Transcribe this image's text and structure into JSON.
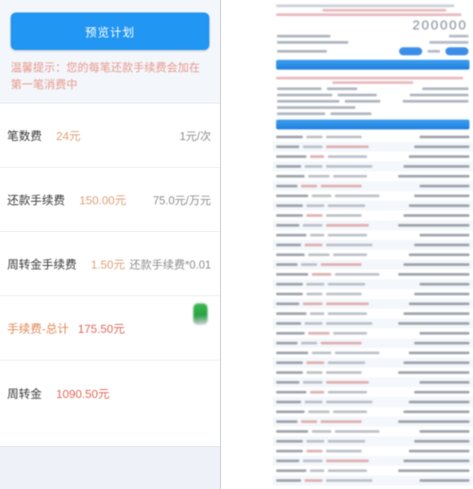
{
  "app": {
    "left_panel_name": "fee-calculation-panel",
    "right_panel_name": "plan-document-preview"
  },
  "hero": {
    "preview_button_label": "预览计划",
    "warning_text": "温馨提示：您的每笔还款手续费会加在第一笔消费中",
    "button_color": "#2196f3",
    "warning_color": "#e8998c"
  },
  "fees": {
    "rows": [
      {
        "label": "笔数费",
        "value": "24元",
        "formula": "1元/次",
        "name": "row-count-fee"
      },
      {
        "label": "还款手续费",
        "value": "150.00元",
        "formula": "75.0元/万元",
        "name": "row-repayment-fee"
      },
      {
        "label": "周转金手续费",
        "value": "1.50元",
        "formula": "还款手续费*0.01",
        "name": "row-working-capital-fee"
      },
      {
        "label": "手续费-总计",
        "value": "175.50元",
        "formula": "",
        "name": "row-total-fee"
      },
      {
        "label": "周转金",
        "value": "1090.50元",
        "formula": "",
        "name": "row-working-capital"
      }
    ],
    "value_color": "#e0a078",
    "total_color": "#e06a5a"
  },
  "icons": {
    "green_badge": "green-battery-icon"
  },
  "document": {
    "headline_number": "200000",
    "accent_color": "#3b8ee8",
    "header_line_count": 4,
    "form_row_count": 4,
    "detail_row_count": 5,
    "table_row_count": 36
  }
}
